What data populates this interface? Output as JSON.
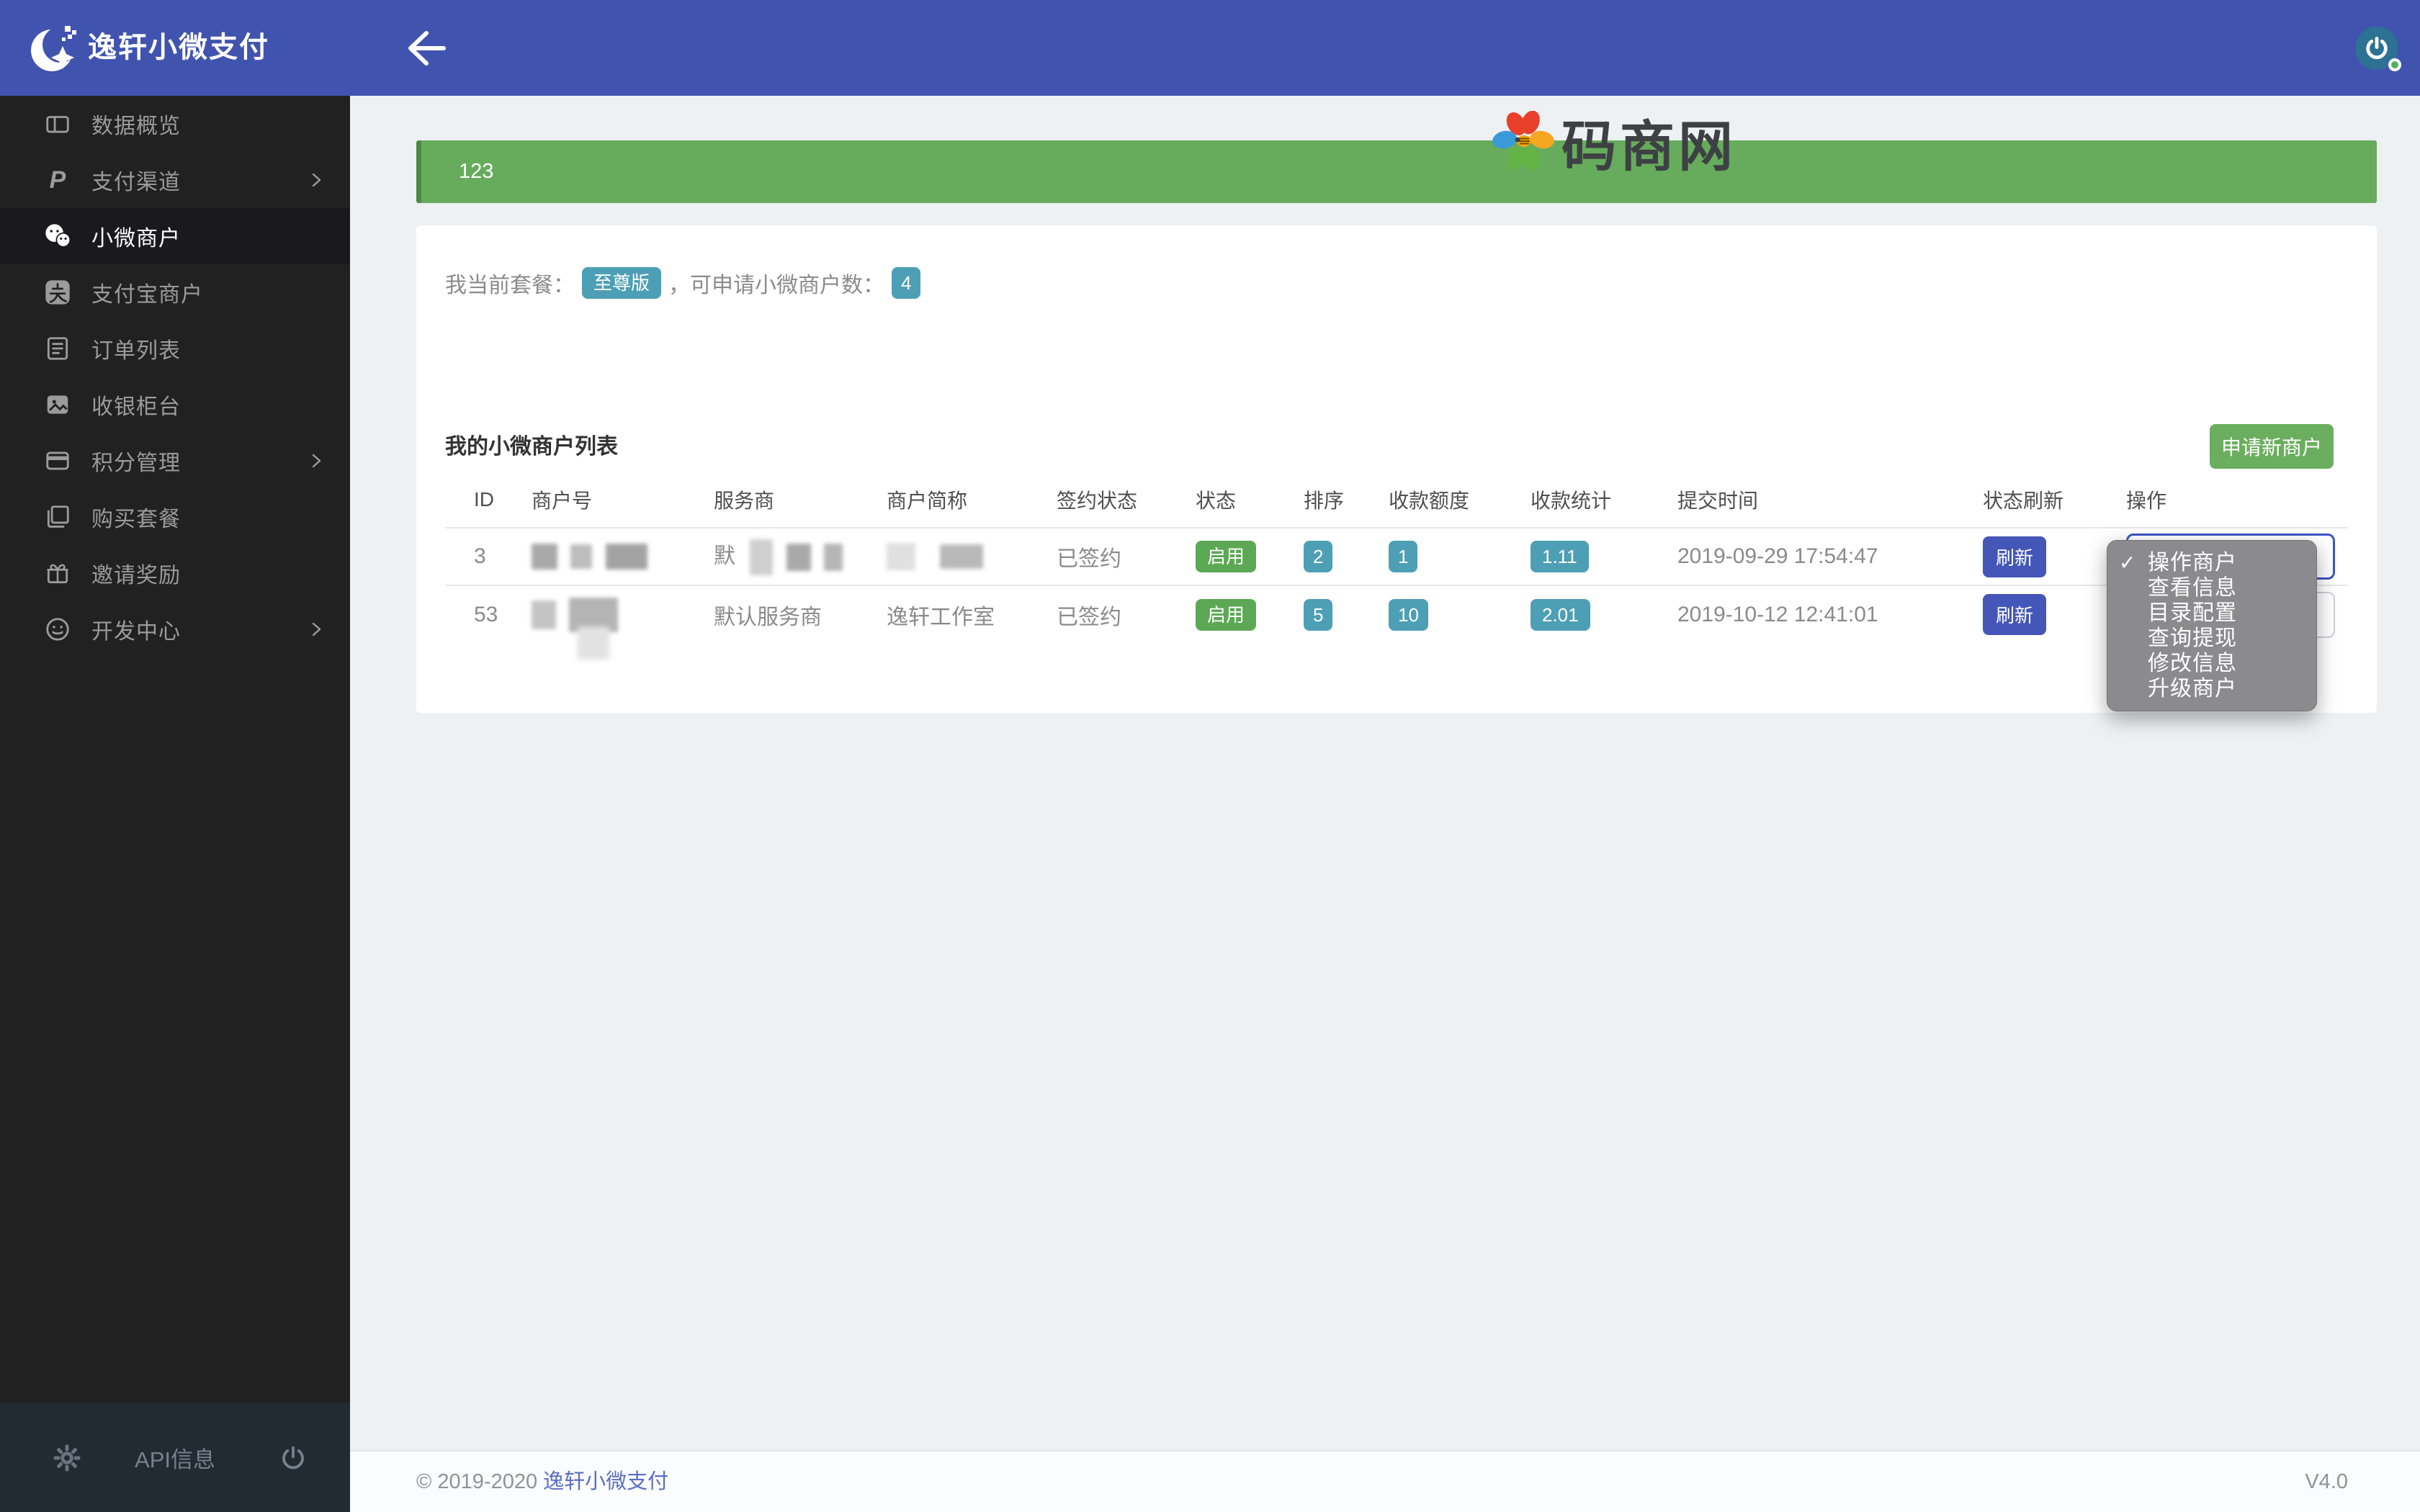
{
  "header": {
    "title": "逸轩小微支付"
  },
  "sidebar": {
    "items": [
      {
        "label": "数据概览",
        "icon": "data-overview-icon",
        "has_submenu": false,
        "active": false
      },
      {
        "label": "支付渠道",
        "icon": "paypal-icon",
        "has_submenu": true,
        "active": false
      },
      {
        "label": "小微商户",
        "icon": "wechat-icon",
        "has_submenu": false,
        "active": true
      },
      {
        "label": "支付宝商户",
        "icon": "alipay-icon",
        "has_submenu": false,
        "active": false
      },
      {
        "label": "订单列表",
        "icon": "order-list-icon",
        "has_submenu": false,
        "active": false
      },
      {
        "label": "收银柜台",
        "icon": "image-icon",
        "has_submenu": false,
        "active": false
      },
      {
        "label": "积分管理",
        "icon": "credit-card-icon",
        "has_submenu": true,
        "active": false
      },
      {
        "label": "购买套餐",
        "icon": "copy-icon",
        "has_submenu": false,
        "active": false
      },
      {
        "label": "邀请奖励",
        "icon": "gift-icon",
        "has_submenu": false,
        "active": false
      },
      {
        "label": "开发中心",
        "icon": "smiley-icon",
        "has_submenu": true,
        "active": false
      }
    ],
    "footer_label": "API信息",
    "paypal_glyph": "P"
  },
  "watermark": {
    "text": "码商网"
  },
  "banner": {
    "text": "123"
  },
  "plan": {
    "prefix": "我当前套餐：",
    "badge": "至尊版",
    "middle": "，可申请小微商户数：",
    "count": "4"
  },
  "list": {
    "title": "我的小微商户列表",
    "apply_button": "申请新商户",
    "columns": [
      "ID",
      "商户号",
      "服务商",
      "商户简称",
      "签约状态",
      "状态",
      "排序",
      "收款额度",
      "收款统计",
      "提交时间",
      "状态刷新",
      "操作"
    ],
    "rows": [
      {
        "id": "3",
        "service_prefix": "默",
        "sign_status": "已签约",
        "status": "启用",
        "sort": "2",
        "quota": "1",
        "stats": "1.11",
        "time": "2019-09-29 17:54:47",
        "refresh_label": "刷新"
      },
      {
        "id": "53",
        "service": "默认服务商",
        "short_name": "逸轩工作室",
        "sign_status": "已签约",
        "status": "启用",
        "sort": "5",
        "quota": "10",
        "stats": "2.01",
        "time": "2019-10-12 12:41:01",
        "refresh_label": "刷新"
      }
    ]
  },
  "dropdown": {
    "check_glyph": "✓",
    "items": [
      "操作商户",
      "查看信息",
      "目录配置",
      "查询提现",
      "修改信息",
      "升级商户"
    ],
    "checked_index": 0
  },
  "page_footer": {
    "copyright": "© 2019-2020 ",
    "link": "逸轩小微支付",
    "version": "V4.0"
  },
  "colors": {
    "header_blue": "#4053af",
    "sidebar_dark": "#212121",
    "banner_green": "#67ac5c",
    "badge_teal": "#4d9fb5",
    "badge_green": "#5ca854",
    "apply_button_green": "#6bae5f",
    "refresh_button_blue": "#4456b7",
    "dropdown_gray": "#8b8b8d",
    "content_bg": "#eef1f4"
  }
}
